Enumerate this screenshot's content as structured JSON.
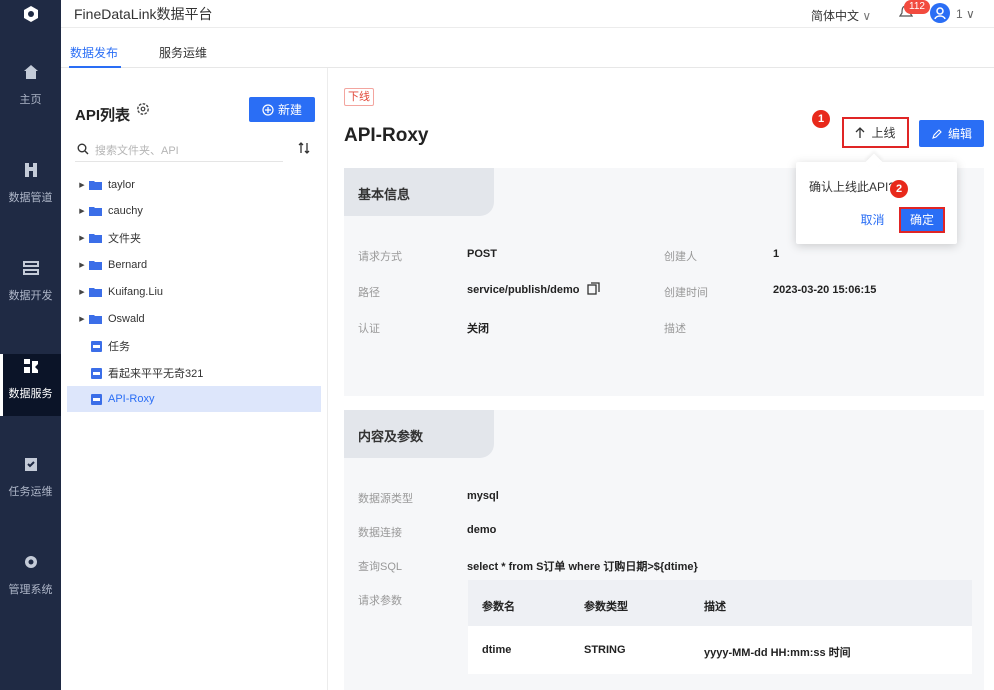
{
  "app": {
    "title": "FineDataLink数据平台",
    "language": "简体中文",
    "notification_count": "112",
    "user_count": "1"
  },
  "nav": [
    {
      "label": "主页",
      "icon": "home-icon"
    },
    {
      "label": "数据管道",
      "icon": "pipeline-icon"
    },
    {
      "label": "数据开发",
      "icon": "develop-icon"
    },
    {
      "label": "数据服务",
      "icon": "service-icon"
    },
    {
      "label": "任务运维",
      "icon": "task-icon"
    },
    {
      "label": "管理系统",
      "icon": "gear-icon"
    }
  ],
  "tabs": [
    "数据发布",
    "服务运维"
  ],
  "sidebar": {
    "title": "API列表",
    "new_label": "新建",
    "search_placeholder": "搜索文件夹、API",
    "tree": [
      {
        "label": "taylor",
        "type": "folder"
      },
      {
        "label": "cauchy",
        "type": "folder"
      },
      {
        "label": "文件夹",
        "type": "folder"
      },
      {
        "label": "Bernard",
        "type": "folder"
      },
      {
        "label": "Kuifang.Liu",
        "type": "folder"
      },
      {
        "label": "Oswald",
        "type": "folder"
      },
      {
        "label": "任务",
        "type": "api"
      },
      {
        "label": "看起来平平无奇321",
        "type": "api"
      },
      {
        "label": "API-Roxy",
        "type": "api",
        "selected": true
      }
    ]
  },
  "detail": {
    "status": "下线",
    "title": "API-Roxy",
    "online_label": "上线",
    "edit_label": "编辑",
    "markers": [
      "1",
      "2"
    ],
    "basic": {
      "title": "基本信息",
      "fields": [
        {
          "label": "请求方式",
          "value": "POST"
        },
        {
          "label": "路径",
          "value": "service/publish/demo"
        },
        {
          "label": "认证",
          "value": "关闭"
        },
        {
          "label": "创建人",
          "value": "1"
        },
        {
          "label": "创建时间",
          "value": "2023-03-20 15:06:15"
        },
        {
          "label": "描述",
          "value": ""
        }
      ]
    },
    "content": {
      "title": "内容及参数",
      "fields": [
        {
          "label": "数据源类型",
          "value": "mysql"
        },
        {
          "label": "数据连接",
          "value": "demo"
        },
        {
          "label": "查询SQL",
          "value": "select * from S订单 where 订购日期>${dtime}"
        },
        {
          "label": "请求参数",
          "value": ""
        }
      ],
      "param_headers": [
        "参数名",
        "参数类型",
        "描述"
      ],
      "params": [
        [
          "dtime",
          "STRING",
          "yyyy-MM-dd HH:mm:ss 时间"
        ]
      ]
    }
  },
  "popover": {
    "question": "确认上线此API?",
    "cancel": "取消",
    "ok": "确定"
  }
}
